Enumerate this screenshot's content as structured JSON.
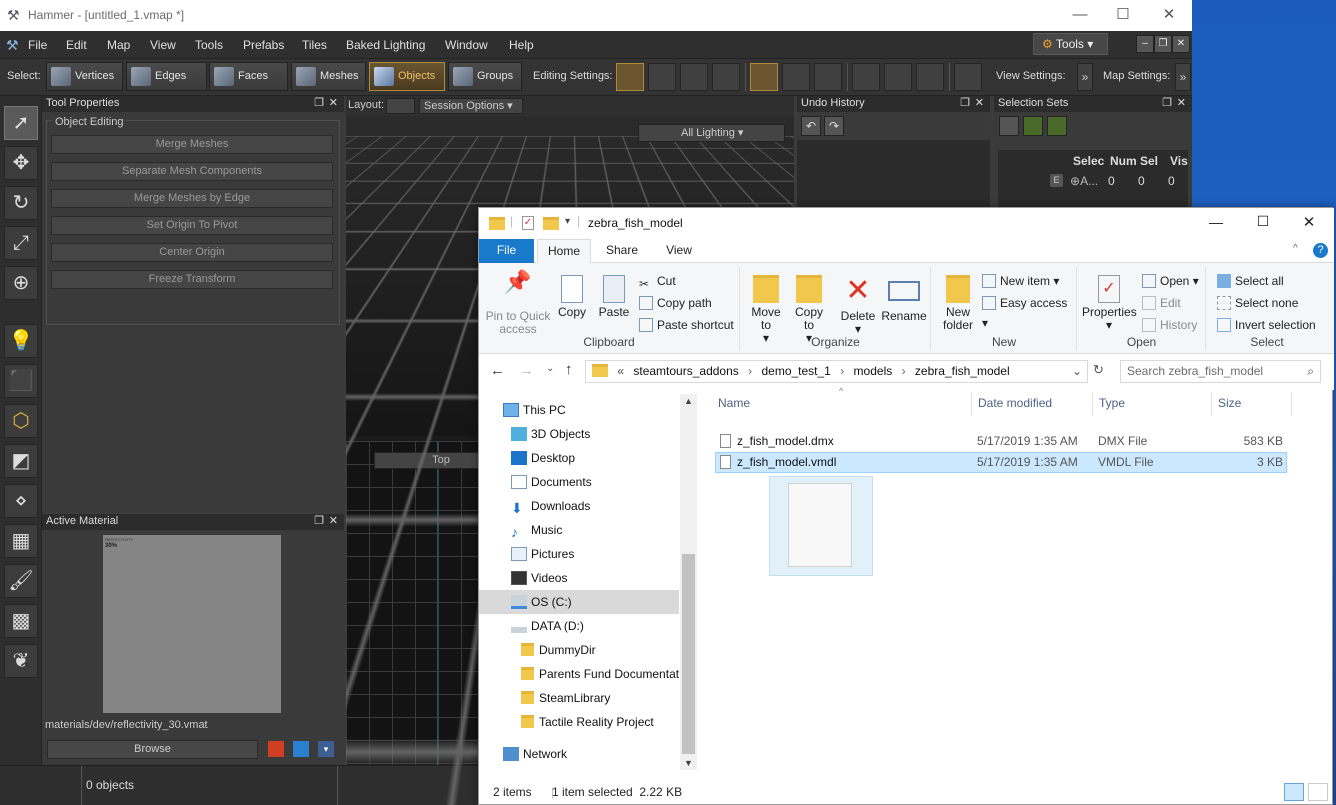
{
  "hammer": {
    "title": "Hammer - [untitled_1.vmap *]",
    "menu": [
      "File",
      "Edit",
      "Map",
      "View",
      "Tools",
      "Prefabs",
      "Tiles",
      "Baked Lighting",
      "Window",
      "Help"
    ],
    "tools_button": "Tools",
    "select_label": "Select:",
    "select_buttons": [
      "Vertices",
      "Edges",
      "Faces",
      "Meshes",
      "Objects",
      "Groups"
    ],
    "editing_settings_label": "Editing Settings:",
    "view_settings_label": "View Settings:",
    "map_settings_label": "Map Settings:",
    "tool_properties": {
      "title": "Tool Properties",
      "group": "Object Editing",
      "buttons": [
        "Merge Meshes",
        "Separate Mesh Components",
        "Merge Meshes by Edge",
        "Set Origin To Pivot",
        "Center Origin",
        "Freeze Transform"
      ]
    },
    "active_material": {
      "title": "Active Material",
      "preview_text_1": "REFLECTIVITY",
      "preview_text_2": "30%",
      "path": "materials/dev/reflectivity_30.vmat",
      "browse": "Browse"
    },
    "viewport": {
      "layout_label": "Layout:",
      "session_options": "Session Options",
      "lighting": "All Lighting",
      "top_label": "Top"
    },
    "undo_history": {
      "title": "Undo History"
    },
    "selection_sets": {
      "title": "Selection Sets",
      "columns": [
        "Selec",
        "Num",
        "Sel",
        "Vis"
      ],
      "row": {
        "name": "A...",
        "num": "0",
        "sel": "0",
        "vis": "0"
      }
    },
    "status": "0 objects"
  },
  "explorer": {
    "title": "zebra_fish_model",
    "tabs": [
      "File",
      "Home",
      "Share",
      "View"
    ],
    "clipboard": {
      "pin": "Pin to Quick access",
      "copy": "Copy",
      "paste": "Paste",
      "cut": "Cut",
      "copy_path": "Copy path",
      "paste_shortcut": "Paste shortcut",
      "label": "Clipboard"
    },
    "organize": {
      "move_to": "Move to",
      "copy_to": "Copy to",
      "delete": "Delete",
      "rename": "Rename",
      "label": "Organize"
    },
    "new": {
      "new_folder": "New folder",
      "new_item": "New item",
      "easy_access": "Easy access",
      "label": "New"
    },
    "open": {
      "properties": "Properties",
      "open": "Open",
      "edit": "Edit",
      "history": "History",
      "label": "Open"
    },
    "select": {
      "select_all": "Select all",
      "select_none": "Select none",
      "invert": "Invert selection",
      "label": "Select"
    },
    "breadcrumb": [
      "steamtours_addons",
      "demo_test_1",
      "models",
      "zebra_fish_model"
    ],
    "breadcrumb_prefix": "«",
    "search_placeholder": "Search zebra_fish_model",
    "nav": [
      "This PC",
      "3D Objects",
      "Desktop",
      "Documents",
      "Downloads",
      "Music",
      "Pictures",
      "Videos",
      "OS (C:)",
      "DATA (D:)",
      "DummyDir",
      "Parents Fund Documentati",
      "SteamLibrary",
      "Tactile Reality Project",
      "Network"
    ],
    "columns": [
      "Name",
      "Date modified",
      "Type",
      "Size"
    ],
    "files": [
      {
        "name": "z_fish_model.dmx",
        "date": "5/17/2019 1:35 AM",
        "type": "DMX File",
        "size": "583 KB"
      },
      {
        "name": "z_fish_model.vmdl",
        "date": "5/17/2019 1:35 AM",
        "type": "VMDL File",
        "size": "3 KB"
      }
    ],
    "status_items": "2 items",
    "status_selected": "1 item selected  2.22 KB"
  }
}
